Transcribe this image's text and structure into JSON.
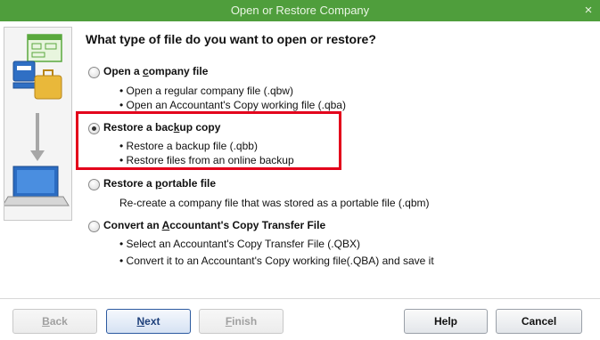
{
  "window": {
    "title": "Open or Restore Company",
    "close_glyph": "×"
  },
  "question": "What type of file do you want to open or restore?",
  "options": [
    {
      "title_pre": "Open a ",
      "title_key": "c",
      "title_post": "ompany file",
      "bullets": [
        "• Open a regular company file (.qbw)",
        "• Open an Accountant's Copy working file (.qba)"
      ],
      "selected": false
    },
    {
      "title_pre": "Restore a bac",
      "title_key": "k",
      "title_post": "up copy",
      "bullets": [
        "• Restore a backup file (.qbb)",
        "• Restore files from an online backup"
      ],
      "selected": true
    },
    {
      "title_pre": "Restore a ",
      "title_key": "p",
      "title_post": "ortable file",
      "bullets": [
        "Re-create a company file that was stored as a portable file (.qbm)"
      ],
      "selected": false
    },
    {
      "title_pre": "Convert an ",
      "title_key": "A",
      "title_post": "ccountant's Copy Transfer File",
      "bullets": [
        "• Select an Accountant's Copy Transfer File (.QBX)",
        "• Convert it to an Accountant's Copy working file(.QBA) and save it"
      ],
      "selected": false
    }
  ],
  "buttons": {
    "back": {
      "key": "B",
      "rest": "ack"
    },
    "next": {
      "key": "N",
      "rest": "ext"
    },
    "finish": {
      "key": "F",
      "rest": "inish"
    },
    "help": "Help",
    "cancel": "Cancel"
  },
  "colors": {
    "titlebar": "#4f9e3c",
    "highlight": "#e3001b"
  }
}
